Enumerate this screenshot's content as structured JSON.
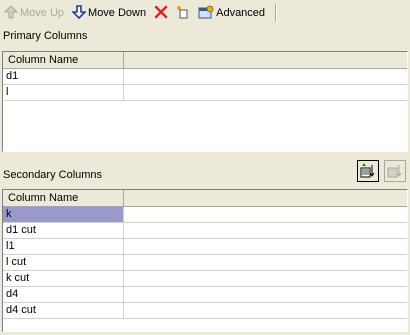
{
  "toolbar": {
    "move_up": {
      "label": "Move Up",
      "enabled": false,
      "icon": "arrow-up-icon"
    },
    "move_down": {
      "label": "Move Down",
      "enabled": true,
      "icon": "arrow-down-icon"
    },
    "delete": {
      "icon": "delete-x-icon"
    },
    "new": {
      "icon": "new-item-icon"
    },
    "advanced": {
      "label": "Advanced",
      "icon": "advanced-settings-icon"
    }
  },
  "primary": {
    "title": "Primary Columns",
    "header": "Column Name",
    "rows": [
      "d1",
      "l"
    ]
  },
  "secondary": {
    "title": "Secondary Columns",
    "header": "Column Name",
    "rows": [
      "k",
      "d1 cut",
      "l1",
      "l cut",
      "k cut",
      "d4",
      "d4 cut"
    ],
    "selected_row": "k"
  },
  "colors": {
    "background": "#ece9d8",
    "selection": "#9999cc",
    "delete_red": "#e02020",
    "move_down_blue": "#1f3aa0"
  }
}
